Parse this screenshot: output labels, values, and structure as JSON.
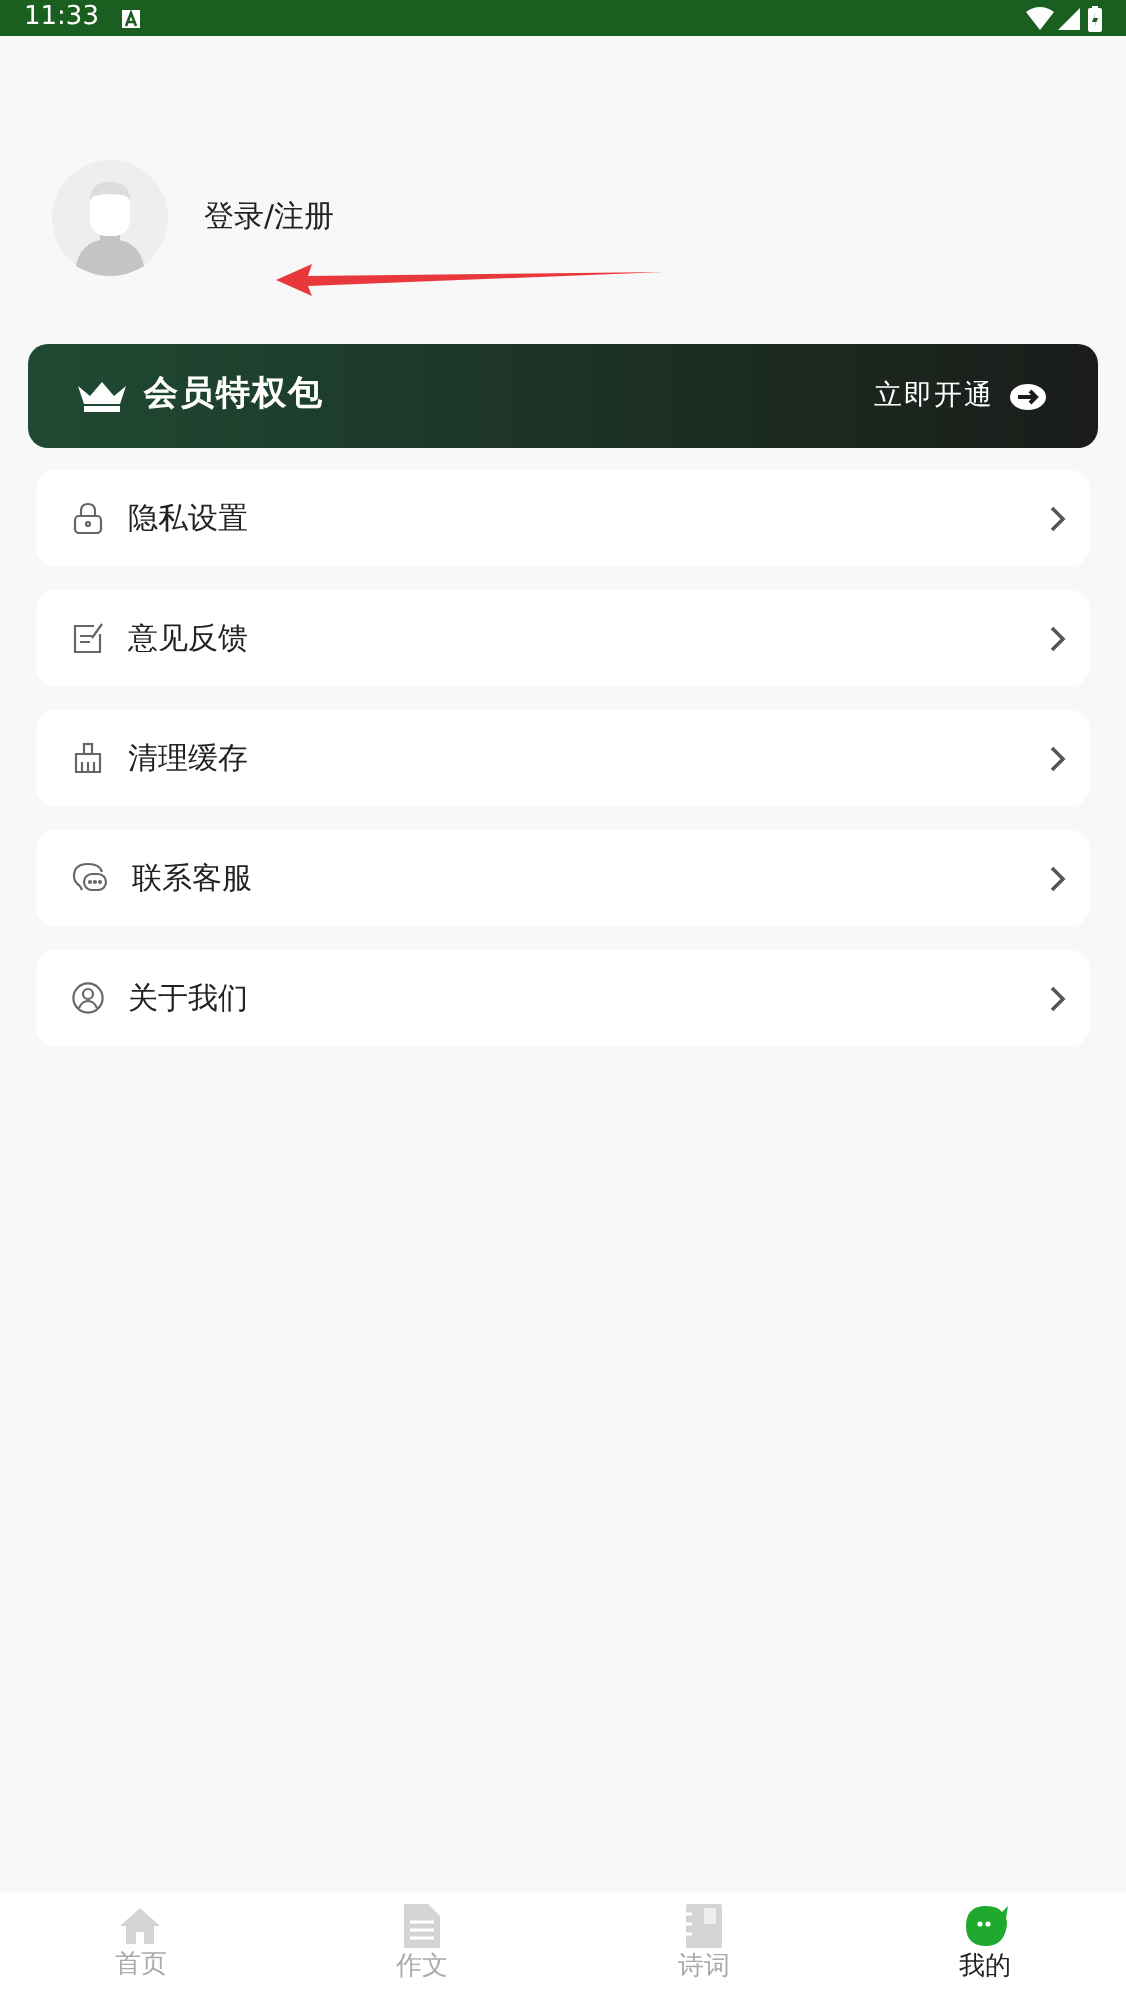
{
  "status_bar": {
    "time": "11:33"
  },
  "profile": {
    "login_label": "登录/注册"
  },
  "vip_banner": {
    "title": "会员特权包",
    "action": "立即开通"
  },
  "menu": [
    {
      "kind": "lock",
      "label": "隐私设置"
    },
    {
      "kind": "feedback",
      "label": "意见反馈"
    },
    {
      "kind": "broom",
      "label": "清理缓存"
    },
    {
      "kind": "chat",
      "label": "联系客服"
    },
    {
      "kind": "person",
      "label": "关于我们"
    }
  ],
  "tabs": [
    {
      "kind": "home",
      "label": "首页",
      "selected": false
    },
    {
      "kind": "document",
      "label": "作文",
      "selected": false
    },
    {
      "kind": "book",
      "label": "诗词",
      "selected": false
    },
    {
      "kind": "face",
      "label": "我的",
      "selected": true
    }
  ]
}
